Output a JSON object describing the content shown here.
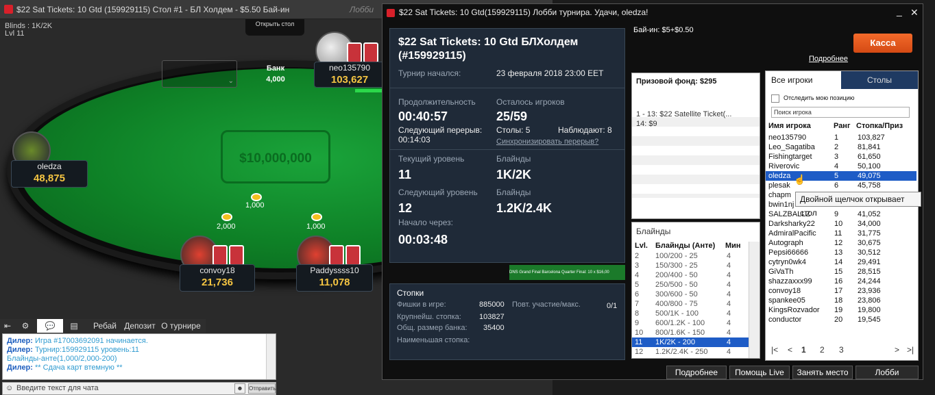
{
  "table": {
    "title": "$22 Sat Tickets: 10 Gtd (159929115) Стол #1 -  БЛ Холдем - $5.50 Бай-ин",
    "lobby_btn": "Лобби",
    "blinds": "Blinds : 1K/2K",
    "level": "Lvl 11",
    "open_table": "Открыть стол",
    "pot_label": "Банк",
    "pot_value": "4,000",
    "logo": "$10,000,000",
    "players": [
      {
        "name": "neo135790",
        "stack": "103,627"
      },
      {
        "name": "oledza",
        "stack": "48,875"
      },
      {
        "name": "convoy18",
        "stack": "21,736"
      },
      {
        "name": "Paddyssss10",
        "stack": "11,078"
      }
    ],
    "bets": [
      "1,000",
      "2,000",
      "1,000"
    ],
    "tabs": [
      "Ребай",
      "Депозит",
      "О турнире"
    ],
    "chat": [
      {
        "who": "Дилер:",
        "msg": " Игра #17003692091 начинается."
      },
      {
        "who": "Дилер:",
        "msg": " Турнир:159929115 уровень:11"
      },
      {
        "who": "",
        "msg": "Блайнды-анте(1,000/2,000-200)"
      },
      {
        "who": "Дилер:",
        "msg": " ** Сдача карт втемную **"
      }
    ],
    "chat_placeholder": "Введите текст для чата",
    "send": "Отправить"
  },
  "lobby": {
    "title": "$22 Sat Tickets: 10 Gtd(159929115) Лобби турнира. Удачи, oledza!",
    "heading": "$22 Sat Tickets: 10 Gtd БЛХолдем (#159929115)",
    "started_label": "Турнир начался:",
    "started_value": "23 февраля 2018  23:00 EET",
    "duration_label": "Продолжительность",
    "duration": "00:40:57",
    "left_label": "Осталось игроков",
    "left": "25/59",
    "next_break_label": "Следующий перерыв:",
    "next_break": "00:14:03",
    "tables": "Столы: 5",
    "observers": "Наблюдают: 8",
    "sync": "Синхронизировать перерыв?",
    "cur_level_label": "Текущий уровень",
    "cur_level": "11",
    "cur_blinds_label": "Блайнды",
    "cur_blinds": "1K/2K",
    "next_level_label": "Следующий уровень",
    "next_level": "12",
    "next_blinds_label": "Блайнды",
    "next_blinds": "1.2K/2.4K",
    "start_in_label": "Начало через:",
    "start_in": "00:03:48",
    "ticker": "DNS Grand Final Barcelona Quarter Final: 10 x $16,00",
    "buyin": "Бай-ин: $5+$0.50",
    "kassa": "Касса",
    "more": "Подробнее",
    "stacks": {
      "title": "Стопки",
      "chips_label": "Фишки в игре:",
      "chips": "885000",
      "biggest_label": "Крупнейш. стопка:",
      "biggest": "103827",
      "avg_label": "Общ. размер банка:",
      "avg": "35400",
      "smallest_label": "Наименьшая стопка:",
      "part_label": "Повт. участие/макс.",
      "part": "0/1"
    },
    "prize_title": "Призовой фонд: $295",
    "prizes": [
      "1 - 13: $22 Satellite Ticket(...",
      "14: $9"
    ],
    "blinds_title": "Блайнды",
    "blinds_head": [
      "Lvl.",
      "Блайнды (Анте)",
      "Мин"
    ],
    "blinds_rows": [
      [
        "2",
        "100/200 - 25",
        "4"
      ],
      [
        "3",
        "150/300 - 25",
        "4"
      ],
      [
        "4",
        "200/400 - 50",
        "4"
      ],
      [
        "5",
        "250/500 - 50",
        "4"
      ],
      [
        "6",
        "300/600 - 50",
        "4"
      ],
      [
        "7",
        "400/800 - 75",
        "4"
      ],
      [
        "8",
        "500/1K - 100",
        "4"
      ],
      [
        "9",
        "600/1.2K - 100",
        "4"
      ],
      [
        "10",
        "800/1.6K - 150",
        "4"
      ],
      [
        "11",
        "1K/2K - 200",
        "4"
      ],
      [
        "12",
        "1.2K/2.4K - 250",
        "4"
      ]
    ],
    "tab_all": "Все игроки",
    "tab_tables": "Столы",
    "track": "Отследить мою позицию",
    "search_ph": "Поиск игрока",
    "player_head": [
      "Имя игрока",
      "Ранг",
      "Стопка/Приз"
    ],
    "players": [
      [
        "neo135790",
        "1",
        "103,827"
      ],
      [
        "Leo_Sagatiba",
        "2",
        "81,841"
      ],
      [
        "Fishingtarget",
        "3",
        "61,650"
      ],
      [
        "Riverovic",
        "4",
        "50,100"
      ],
      [
        "oledza",
        "5",
        "49,075"
      ],
      [
        "plesak",
        "6",
        "45,758"
      ],
      [
        "chapm",
        "7",
        ""
      ],
      [
        "bwin1nj",
        "8",
        ""
      ],
      [
        "SALZBALLZ",
        "9",
        "41,052"
      ],
      [
        "Darksharky22",
        "10",
        "34,000"
      ],
      [
        "AdmiralPacific",
        "11",
        "31,775"
      ],
      [
        "Autograph",
        "12",
        "30,675"
      ],
      [
        "Pepsi66666",
        "13",
        "30,512"
      ],
      [
        "cytryn0wk4",
        "14",
        "29,491"
      ],
      [
        "GiVaTh",
        "15",
        "28,515"
      ],
      [
        "shazzaxxx99",
        "16",
        "24,244"
      ],
      [
        "convoy18",
        "17",
        "23,936"
      ],
      [
        "spankee05",
        "18",
        "23,806"
      ],
      [
        "KingsRozvador",
        "19",
        "19,800"
      ],
      [
        "conductor",
        "20",
        "19,545"
      ]
    ],
    "tooltip": "Двойной щелчок открывает стол",
    "pages": [
      "1",
      "2",
      "3"
    ],
    "buttons": [
      "Подробнее",
      "Помощь Live",
      "Занять место",
      "Лобби"
    ]
  }
}
